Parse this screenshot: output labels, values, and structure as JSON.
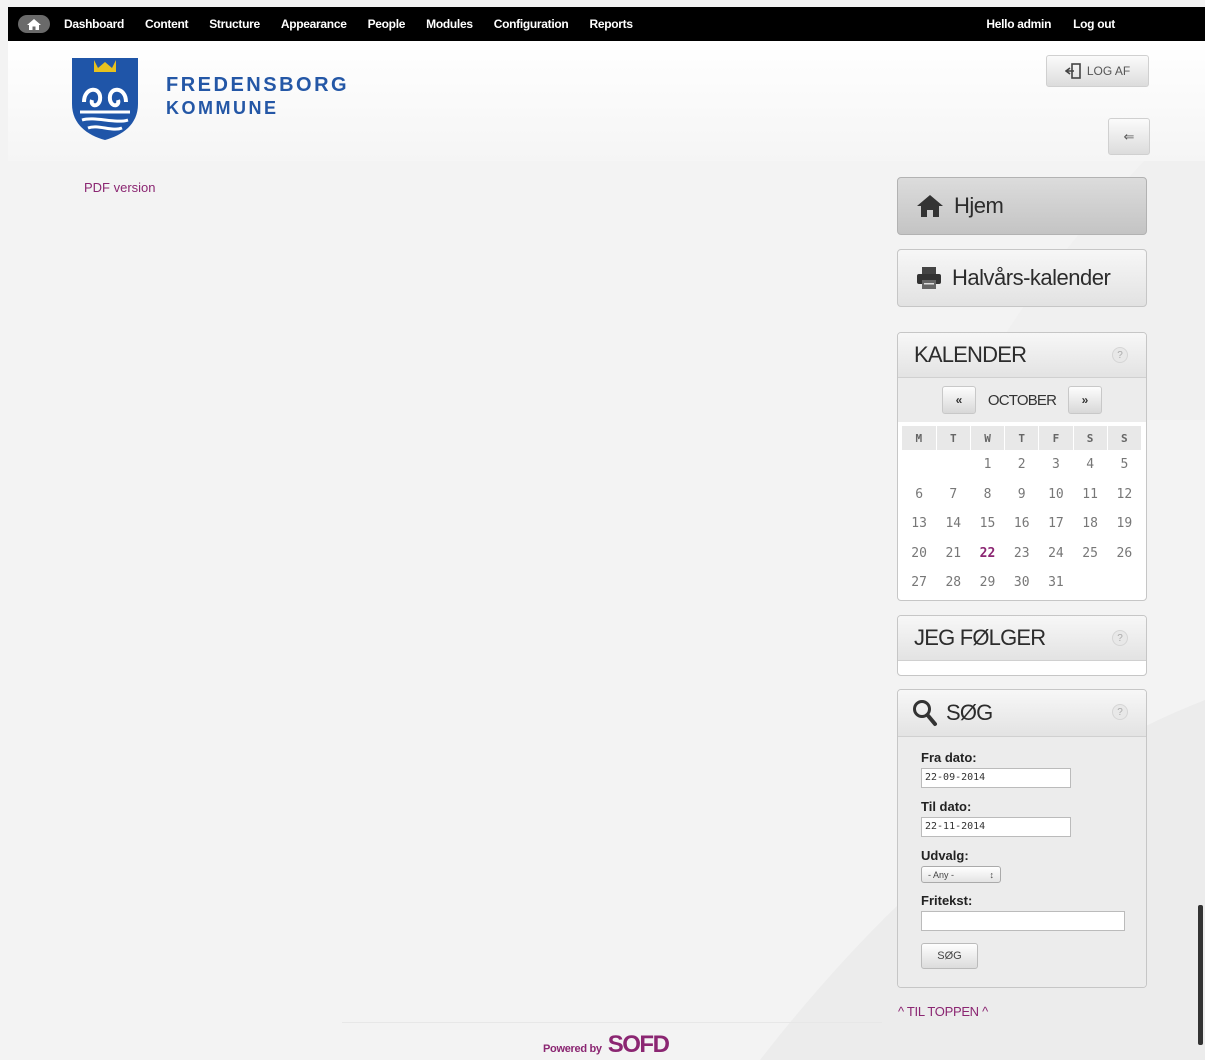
{
  "admin_bar": {
    "menu": [
      "Dashboard",
      "Content",
      "Structure",
      "Appearance",
      "People",
      "Modules",
      "Configuration",
      "Reports"
    ],
    "greeting": "Hello admin",
    "logout": "Log out"
  },
  "header": {
    "logo_line1": "FREDENSBORG",
    "logo_line2": "KOMMUNE",
    "logout_button": "LOG AF",
    "collapse_button": "⇐"
  },
  "main": {
    "pdf_link": "PDF version"
  },
  "sidebar": {
    "nav": [
      {
        "label": "Hjem",
        "icon": "home-icon",
        "active": true
      },
      {
        "label": "Halvårs-kalender",
        "icon": "printer-icon",
        "active": false
      }
    ],
    "calendar": {
      "title": "KALENDER",
      "help": "?",
      "prev": "«",
      "next": "»",
      "month": "OCTOBER",
      "weekdays": [
        "M",
        "T",
        "W",
        "T",
        "F",
        "S",
        "S"
      ],
      "weeks": [
        [
          "",
          "",
          "1",
          "2",
          "3",
          "4",
          "5"
        ],
        [
          "6",
          "7",
          "8",
          "9",
          "10",
          "11",
          "12"
        ],
        [
          "13",
          "14",
          "15",
          "16",
          "17",
          "18",
          "19"
        ],
        [
          "20",
          "21",
          "22",
          "23",
          "24",
          "25",
          "26"
        ],
        [
          "27",
          "28",
          "29",
          "30",
          "31",
          "",
          ""
        ]
      ],
      "today": "22"
    },
    "following": {
      "title": "JEG FØLGER",
      "help": "?"
    },
    "search": {
      "title": "SØG",
      "help": "?",
      "from_label": "Fra dato:",
      "from_value": "22-09-2014",
      "to_label": "Til dato:",
      "to_value": "22-11-2014",
      "committee_label": "Udvalg:",
      "committee_value": "- Any -",
      "freetext_label": "Fritekst:",
      "freetext_value": "",
      "submit": "SØG"
    },
    "to_top": "^ TIL TOPPEN ^"
  },
  "footer": {
    "powered_by": "Powered by",
    "brand": "SOFD"
  }
}
